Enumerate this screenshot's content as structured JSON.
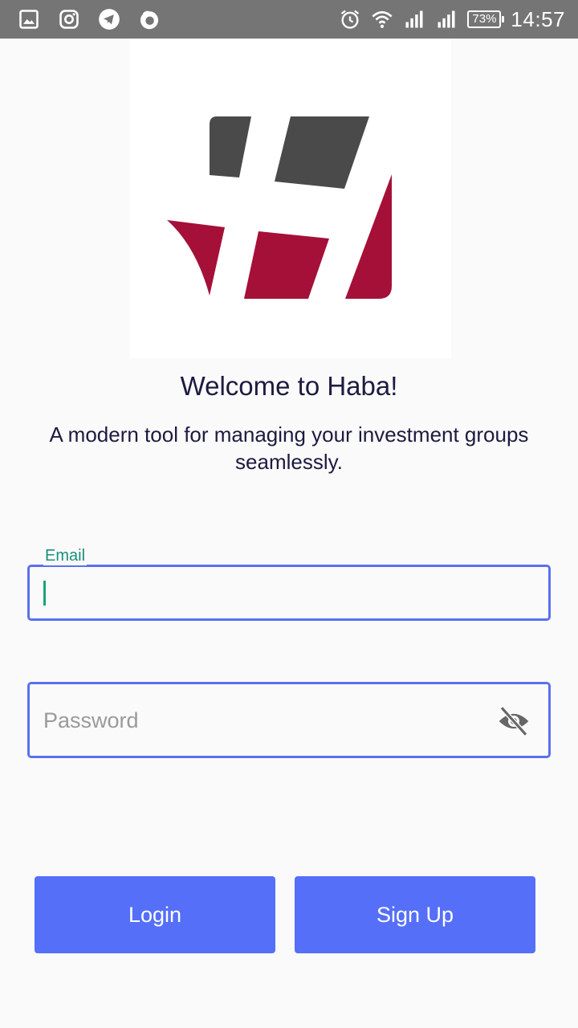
{
  "status_bar": {
    "left_icons": [
      "gallery-icon",
      "instagram-icon",
      "telegram-icon",
      "firefox-icon"
    ],
    "right_icons": [
      "alarm-icon",
      "wifi-icon",
      "signal-icon",
      "signal-icon"
    ],
    "battery": "73%",
    "time": "14:57",
    "background": "#757575"
  },
  "logo": {
    "name": "haba-logo-icon",
    "colors": {
      "dark": "#4a4a4a",
      "accent": "#a51038"
    }
  },
  "welcome": {
    "title": "Welcome to Haba!",
    "subtitle": "A modern tool for managing your investment groups seamlessly."
  },
  "form": {
    "email": {
      "label": "Email",
      "value": ""
    },
    "password": {
      "placeholder": "Password",
      "value": "",
      "toggle_icon": "eye-off-icon"
    },
    "border_color": "#5a70ee",
    "label_color": "#1a8f7e"
  },
  "actions": {
    "login_label": "Login",
    "signup_label": "Sign Up",
    "color": "#556ff9"
  }
}
